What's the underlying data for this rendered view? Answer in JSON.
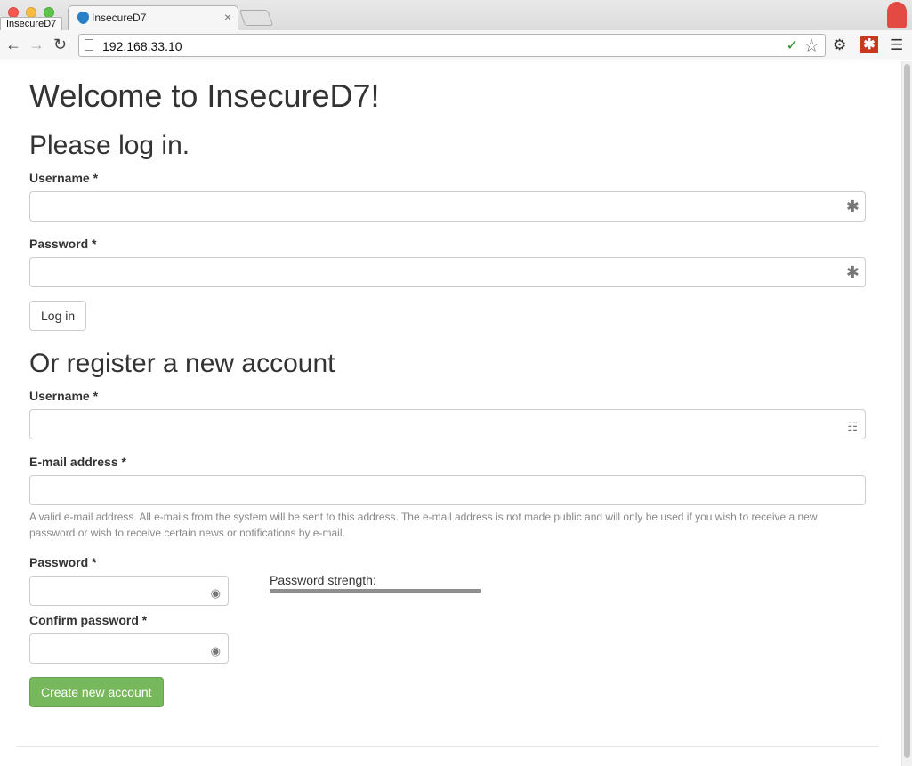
{
  "browser": {
    "window_label": "InsecureD7",
    "tab_title": "InsecureD7",
    "tab_close": "×",
    "url": "192.168.33.10",
    "icons": {
      "back": "arrow-left",
      "forward": "arrow-right",
      "reload": "reload",
      "page": "page",
      "star": "star",
      "extension_check": "check",
      "settings": "gear",
      "extension": "asterisk",
      "menu": "hamburger"
    }
  },
  "page": {
    "title": "Welcome to InsecureD7!",
    "login": {
      "heading": "Please log in.",
      "username_label": "Username *",
      "password_label": "Password *",
      "submit_label": "Log in"
    },
    "register": {
      "heading": "Or register a new account",
      "username_label": "Username *",
      "email_label": "E-mail address *",
      "email_help": "A valid e-mail address. All e-mails from the system will be sent to this address. The e-mail address is not made public and will only be used if you wish to receive a new password or wish to receive certain news or notifications by e-mail.",
      "password_label": "Password *",
      "confirm_label": "Confirm password *",
      "strength_label": "Password strength:",
      "submit_label": "Create new account"
    }
  },
  "colors": {
    "success": "#78b85c",
    "text": "#333333",
    "help_text": "#888888"
  }
}
